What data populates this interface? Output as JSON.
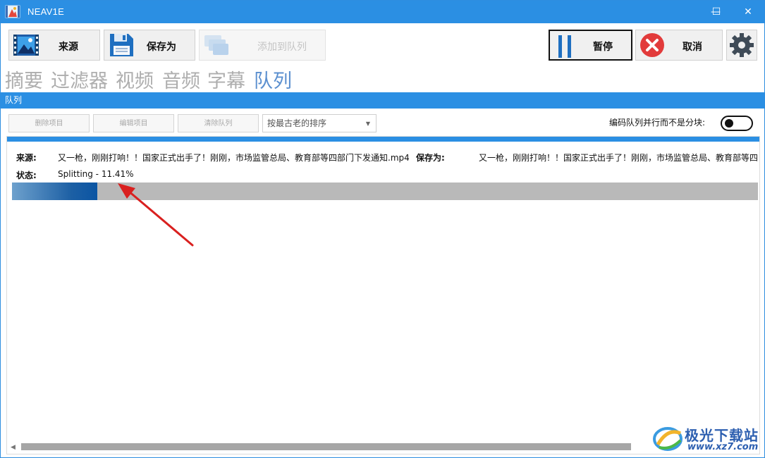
{
  "window": {
    "title": "NEAV1E",
    "controls": {
      "minimize": "—",
      "maximize": "☐",
      "close": "✕"
    }
  },
  "toolbar": {
    "source_label": "来源",
    "save_as_label": "保存为",
    "add_to_queue_label": "添加到队列",
    "pause_label": "暂停",
    "cancel_label": "取消",
    "icons": {
      "source": "video-clip-icon",
      "save_as": "floppy-disk-icon",
      "add_to_queue": "stacked-frames-icon",
      "pause": "pause-icon",
      "cancel": "red-x-circle-icon",
      "settings": "gear-icon"
    }
  },
  "steps": {
    "items": [
      "摘要",
      "过滤器",
      "视频",
      "音频",
      "字幕",
      "队列"
    ],
    "active": "队列"
  },
  "section": {
    "title": "队列"
  },
  "queue_actions": {
    "delete_item": "删除项目",
    "edit_item": "编辑项目",
    "clear_queue": "清除队列",
    "sort_selected": "按最古老的排序",
    "parallel_label": "编码队列并行而不是分块:",
    "parallel_enabled": false
  },
  "queue_item": {
    "source_key": "来源:",
    "source_value": "又一枪，刚刚打响！！国家正式出手了！刚刚，市场监管总局、教育部等四部门下发通知.mp4",
    "save_key": "保存为:",
    "save_value": "又一枪，刚刚打响！！国家正式出手了！刚刚，市场监管总局、教育部等四",
    "status_key": "状态:",
    "status_value": "Splitting - 11.41%",
    "progress_percent": 11.41
  },
  "colors": {
    "accent": "#2b8fe3",
    "active_step": "#5b8fcf",
    "inactive_step": "#aeaeae",
    "progress_fill": "#0b55a3",
    "progress_track": "#b9b9b9",
    "annotation_arrow": "#d9201f"
  },
  "watermark": {
    "text": "极光下载站",
    "url": "www.xz7.com"
  }
}
